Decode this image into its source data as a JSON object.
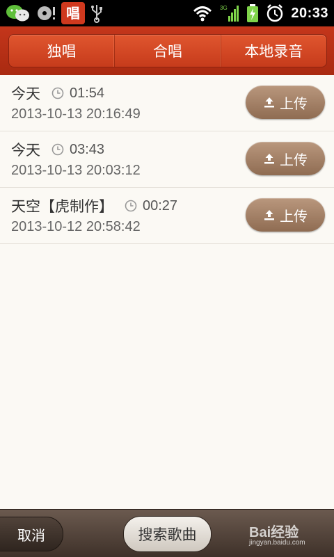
{
  "status_bar": {
    "time": "20:33",
    "app_icon_label": "唱",
    "network_label": "3G",
    "icons": [
      "wechat-icon",
      "cd-icon",
      "sing-app-icon",
      "usb-icon",
      "wifi-icon",
      "signal-icon",
      "battery-charging-icon",
      "alarm-icon"
    ]
  },
  "tabs": [
    {
      "label": "独唱"
    },
    {
      "label": "合唱"
    },
    {
      "label": "本地录音"
    }
  ],
  "recordings": [
    {
      "title": "今天",
      "duration": "01:54",
      "date": "2013-10-13 20:16:49",
      "upload_label": "上传"
    },
    {
      "title": "今天",
      "duration": "03:43",
      "date": "2013-10-13 20:03:12",
      "upload_label": "上传"
    },
    {
      "title": "天空【虎制作】",
      "duration": "00:27",
      "date": "2013-10-12 20:58:42",
      "upload_label": "上传"
    }
  ],
  "bottom_bar": {
    "cancel_label": "取消",
    "search_label": "搜索歌曲",
    "watermark_brand": "Bai经验",
    "watermark_url": "jingyan.baidu.com"
  },
  "colors": {
    "header": "#c4361b",
    "upload_button": "#a5826a",
    "background": "#fbf9f4"
  }
}
